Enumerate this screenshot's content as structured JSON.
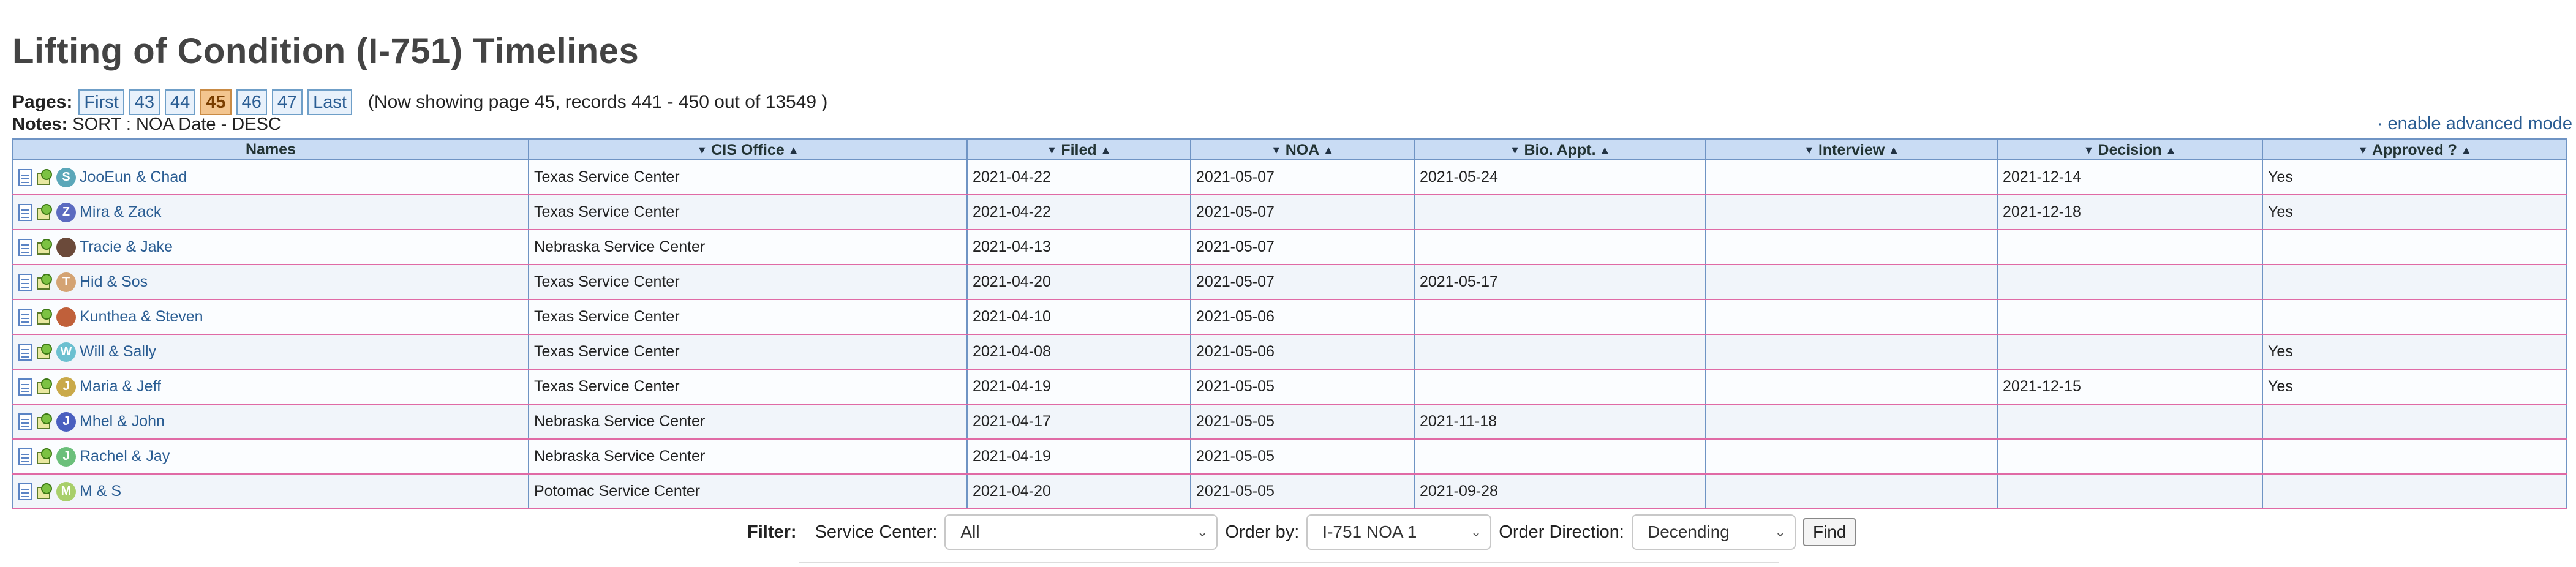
{
  "page": {
    "title": "Lifting of Condition (I-751) Timelines"
  },
  "pagination": {
    "label": "Pages:",
    "links": [
      "First",
      "43",
      "44",
      "45",
      "46",
      "47",
      "Last"
    ],
    "current": "45",
    "showing": "(Now showing page 45, records 441 - 450 out of 13549 )"
  },
  "notes": {
    "label": "Notes:",
    "text": "SORT : NOA Date - DESC"
  },
  "advanced_link": "· enable advanced mode",
  "table": {
    "headers": [
      "Names",
      "CIS Office",
      "Filed",
      "NOA",
      "Bio. Appt.",
      "Interview",
      "Decision",
      "Approved ?"
    ],
    "rows": [
      {
        "name": "JooEun & Chad",
        "initial": "S",
        "avatar_color": "#5ba7b9",
        "office": "Texas Service Center",
        "filed": "2021-04-22",
        "noa": "2021-05-07",
        "bio": "2021-05-24",
        "interview": "",
        "decision": "2021-12-14",
        "approved": "Yes"
      },
      {
        "name": "Mira & Zack",
        "initial": "Z",
        "avatar_color": "#5c6bc0",
        "office": "Texas Service Center",
        "filed": "2021-04-22",
        "noa": "2021-05-07",
        "bio": "",
        "interview": "",
        "decision": "2021-12-18",
        "approved": "Yes"
      },
      {
        "name": "Tracie & Jake",
        "initial": "",
        "avatar_color": "#6b4a3a",
        "office": "Nebraska Service Center",
        "filed": "2021-04-13",
        "noa": "2021-05-07",
        "bio": "",
        "interview": "",
        "decision": "",
        "approved": ""
      },
      {
        "name": "Hid & Sos",
        "initial": "T",
        "avatar_color": "#d4a373",
        "office": "Texas Service Center",
        "filed": "2021-04-20",
        "noa": "2021-05-07",
        "bio": "2021-05-17",
        "interview": "",
        "decision": "",
        "approved": ""
      },
      {
        "name": "Kunthea & Steven",
        "initial": "",
        "avatar_color": "#c0603a",
        "office": "Texas Service Center",
        "filed": "2021-04-10",
        "noa": "2021-05-06",
        "bio": "",
        "interview": "",
        "decision": "",
        "approved": ""
      },
      {
        "name": "Will & Sally",
        "initial": "W",
        "avatar_color": "#6cc0d0",
        "office": "Texas Service Center",
        "filed": "2021-04-08",
        "noa": "2021-05-06",
        "bio": "",
        "interview": "",
        "decision": "",
        "approved": "Yes"
      },
      {
        "name": "Maria & Jeff",
        "initial": "J",
        "avatar_color": "#c9a94a",
        "office": "Texas Service Center",
        "filed": "2021-04-19",
        "noa": "2021-05-05",
        "bio": "",
        "interview": "",
        "decision": "2021-12-15",
        "approved": "Yes"
      },
      {
        "name": "Mhel & John",
        "initial": "J",
        "avatar_color": "#4a5fbf",
        "office": "Nebraska Service Center",
        "filed": "2021-04-17",
        "noa": "2021-05-05",
        "bio": "2021-11-18",
        "interview": "",
        "decision": "",
        "approved": ""
      },
      {
        "name": "Rachel & Jay",
        "initial": "J",
        "avatar_color": "#6bbf7a",
        "office": "Nebraska Service Center",
        "filed": "2021-04-19",
        "noa": "2021-05-05",
        "bio": "",
        "interview": "",
        "decision": "",
        "approved": ""
      },
      {
        "name": "M & S",
        "initial": "M",
        "avatar_color": "#a8cf6a",
        "office": "Potomac Service Center",
        "filed": "2021-04-20",
        "noa": "2021-05-05",
        "bio": "2021-09-28",
        "interview": "",
        "decision": "",
        "approved": ""
      }
    ]
  },
  "filter": {
    "label": "Filter:",
    "service_center_label": "Service Center:",
    "service_center_value": "All",
    "order_by_label": "Order by:",
    "order_by_value": "I-751 NOA 1",
    "order_direction_label": "Order Direction:",
    "order_direction_value": "Decending",
    "find_label": "Find"
  }
}
